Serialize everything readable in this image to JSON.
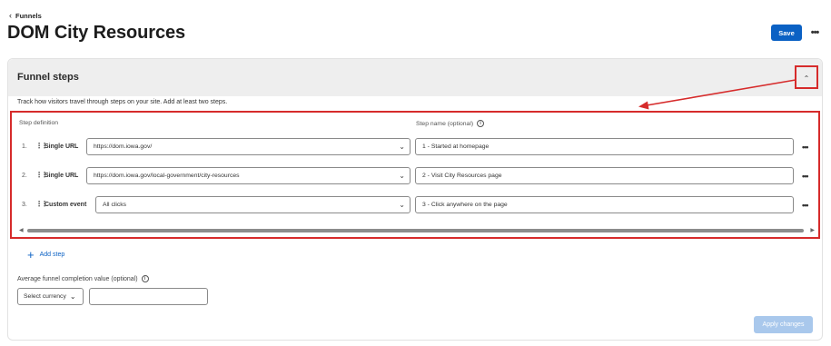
{
  "breadcrumb": {
    "back_label": "Funnels"
  },
  "page": {
    "title": "DOM City Resources"
  },
  "toolbar": {
    "save_label": "Save",
    "more_label": "•••"
  },
  "funnel_steps": {
    "title": "Funnel steps",
    "hint": "Track how visitors travel through steps on your site. Add at least two steps.",
    "step_definition_label": "Step definition",
    "step_name_label": "Step name (optional)",
    "steps": [
      {
        "number": "1.",
        "type": "Single URL",
        "definition": "https://dom.iowa.gov/",
        "name": "1 - Started at homepage"
      },
      {
        "number": "2.",
        "type": "Single URL",
        "definition": "https://dom.iowa.gov/local-government/city-resources",
        "name": "2 - Visit City Resources page"
      },
      {
        "number": "3.",
        "type": "Custom event",
        "definition": "All clicks",
        "name": "3 - Click anywhere on the page"
      }
    ],
    "add_step_label": "Add step",
    "avg_completion_label": "Average funnel completion value (optional)",
    "currency_placeholder": "Select currency",
    "value_input": "",
    "apply_label": "Apply changes"
  },
  "icons": {
    "back": "chevron-left-icon",
    "collapse": "chevron-up-icon",
    "info": "info-icon",
    "drag": "drag-handle-icon",
    "dropdown": "chevron-down-icon",
    "add": "plus-icon",
    "more": "more-horizontal-icon"
  },
  "colors": {
    "accent": "#0b61c4",
    "annotation": "#d62b2b",
    "header_bg": "#eeeeee",
    "apply_disabled": "#a9c8ec"
  }
}
